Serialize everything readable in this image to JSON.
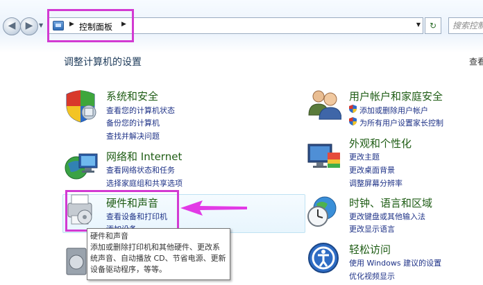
{
  "address_bar": {
    "breadcrumb": "控制面板",
    "search_placeholder": "搜索控制面板"
  },
  "page": {
    "title": "调整计算机的设置",
    "view_by": "查看方式"
  },
  "categories": {
    "system": {
      "title": "系统和安全",
      "links": [
        "查看您的计算机状态",
        "备份您的计算机",
        "查找并解决问题"
      ]
    },
    "network": {
      "title": "网络和 Internet",
      "links": [
        "查看网络状态和任务",
        "选择家庭组和共享选项"
      ]
    },
    "hardware": {
      "title": "硬件和声音",
      "links": [
        "查看设备和打印机",
        "添加设备"
      ]
    },
    "users": {
      "title": "用户帐户和家庭安全",
      "links": [
        "添加或删除用户帐户",
        "为所有用户设置家长控制"
      ]
    },
    "appearance": {
      "title": "外观和个性化",
      "links": [
        "更改主题",
        "更改桌面背景",
        "调整屏幕分辨率"
      ]
    },
    "clock": {
      "title": "时钟、语言和区域",
      "links": [
        "更改键盘或其他输入法",
        "更改显示语言"
      ]
    },
    "access": {
      "title": "轻松访问",
      "links": [
        "使用 Windows 建议的设置",
        "优化视频显示"
      ]
    }
  },
  "tooltip": {
    "title": "硬件和声音",
    "body": "添加或删除打印机和其他硬件、更改系统声音、自动播放 CD、节省电源、更新设备驱动程序，等等。"
  },
  "colors": {
    "annotation": "#d23ad2",
    "category_title": "#1e5c14",
    "link": "#1e3287"
  }
}
